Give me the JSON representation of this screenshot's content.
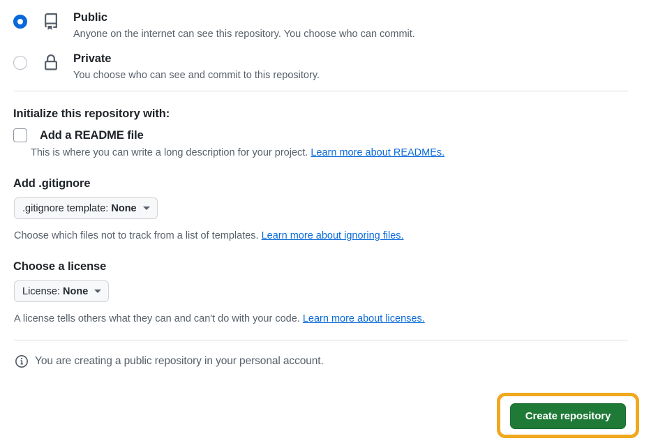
{
  "visibility": {
    "options": [
      {
        "id": "public",
        "icon": "repo-book-icon",
        "title": "Public",
        "description": "Anyone on the internet can see this repository. You choose who can commit.",
        "selected": true
      },
      {
        "id": "private",
        "icon": "lock-icon",
        "title": "Private",
        "description": "You choose who can see and commit to this repository.",
        "selected": false
      }
    ]
  },
  "initialize": {
    "heading": "Initialize this repository with:",
    "readme": {
      "label": "Add a README file",
      "checked": false,
      "hint_text": "This is where you can write a long description for your project.",
      "hint_link": "Learn more about READMEs."
    }
  },
  "gitignore": {
    "heading": "Add .gitignore",
    "select_prefix": ".gitignore template:",
    "select_value": "None",
    "hint_text": "Choose which files not to track from a list of templates.",
    "hint_link": "Learn more about ignoring files."
  },
  "license": {
    "heading": "Choose a license",
    "select_prefix": "License:",
    "select_value": "None",
    "hint_text": "A license tells others what they can and can't do with your code.",
    "hint_link": "Learn more about licenses."
  },
  "info_note": {
    "icon": "info-circle-icon",
    "text": "You are creating a public repository in your personal account."
  },
  "actions": {
    "create_button_label": "Create repository"
  },
  "colors": {
    "link": "#0969da",
    "radio_selected": "#0969da",
    "button_green": "#1f7a38",
    "highlight_ring": "#f0a81e",
    "divider": "#d8dee4",
    "muted_text": "#57606a",
    "select_background": "#f6f8fa"
  }
}
